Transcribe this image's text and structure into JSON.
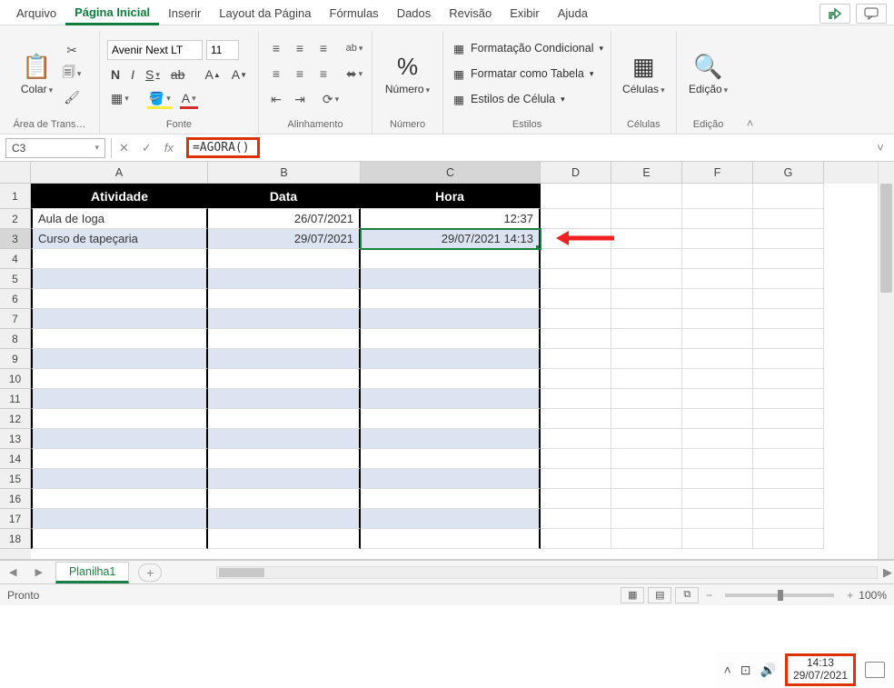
{
  "menu": {
    "tabs": [
      "Arquivo",
      "Página Inicial",
      "Inserir",
      "Layout da Página",
      "Fórmulas",
      "Dados",
      "Revisão",
      "Exibir",
      "Ajuda"
    ],
    "active_index": 1
  },
  "ribbon": {
    "clipboard": {
      "label": "Área de Trans…",
      "paste": "Colar"
    },
    "font": {
      "label": "Fonte",
      "name": "Avenir Next LT",
      "size": "11",
      "buttons": {
        "bold": "N",
        "italic": "I",
        "underline": "S",
        "strike": "ab"
      }
    },
    "alignment": {
      "label": "Alinhamento"
    },
    "number": {
      "label": "Número",
      "big": "Número"
    },
    "styles": {
      "label": "Estilos",
      "items": [
        "Formatação Condicional",
        "Formatar como Tabela",
        "Estilos de Célula"
      ]
    },
    "cells": {
      "label": "Células",
      "big": "Células"
    },
    "editing": {
      "label": "Edição",
      "big": "Edição"
    }
  },
  "formula_bar": {
    "name_box": "C3",
    "formula": "=AGORA()",
    "fx": "fx"
  },
  "grid": {
    "cols": [
      {
        "letter": "A",
        "w": 195
      },
      {
        "letter": "B",
        "w": 168
      },
      {
        "letter": "C",
        "w": 198
      },
      {
        "letter": "D",
        "w": 78
      },
      {
        "letter": "E",
        "w": 78
      },
      {
        "letter": "F",
        "w": 78
      },
      {
        "letter": "G",
        "w": 78
      }
    ],
    "headers": [
      "Atividade",
      "Data",
      "Hora"
    ],
    "rows": [
      {
        "a": "Aula de Ioga",
        "b": "26/07/2021",
        "c": "12:37"
      },
      {
        "a": "Curso de tapeçaria",
        "b": "29/07/2021",
        "c": "29/07/2021 14:13"
      }
    ],
    "selected": "C3",
    "blank_rows": 15
  },
  "sheet": {
    "tab": "Planilha1"
  },
  "status": {
    "ready": "Pronto",
    "zoom": "100%"
  },
  "system": {
    "time": "14:13",
    "date": "29/07/2021"
  }
}
